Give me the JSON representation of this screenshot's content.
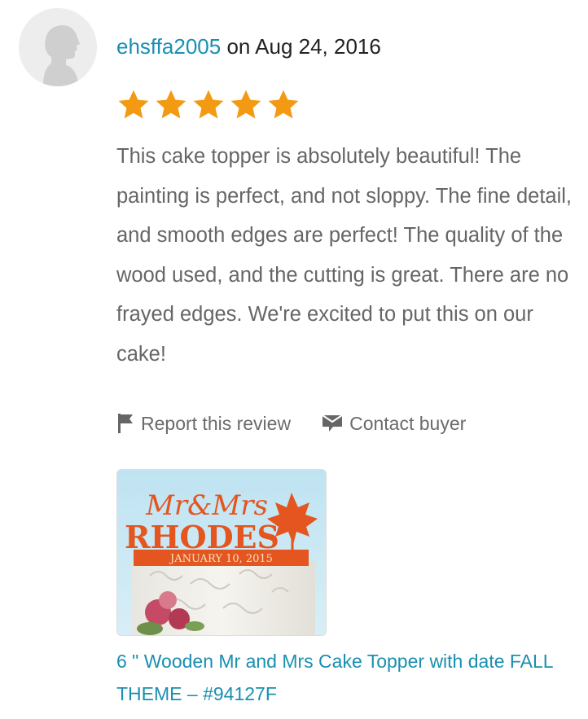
{
  "review": {
    "reviewer_name": "ehsffa2005",
    "date_text": "on Aug 24, 2016",
    "rating": 5,
    "rating_max": 5,
    "text": "This cake topper is absolutely beautiful! The painting is perfect, and not sloppy. The fine detail, and smooth edges are perfect! The quality of the wood used, and the cutting is great. There are no frayed edges. We're excited to put this on our cake!"
  },
  "actions": {
    "report_label": "Report this review",
    "report_icon": "flag-icon",
    "contact_label": "Contact buyer",
    "contact_icon": "message-icon"
  },
  "product": {
    "topper_line1": "Mr&Mrs",
    "topper_line2": "RHODES",
    "topper_date": "JANUARY 10, 2015",
    "title": "6 \" Wooden Mr and Mrs Cake Topper with date FALL THEME – #94127F"
  },
  "colors": {
    "link": "#1a8fb0",
    "star": "#f49a12",
    "body_text": "#666666",
    "topper_orange": "#e4551f"
  }
}
